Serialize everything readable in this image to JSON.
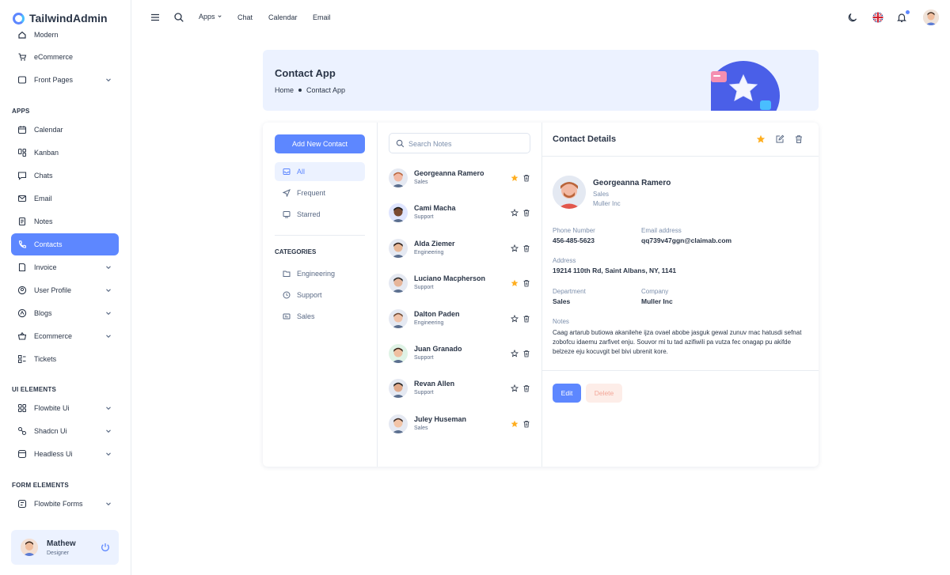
{
  "app": {
    "name": "TailwindAdmin"
  },
  "sidebar": {
    "partial_item": "Modern",
    "items_top": [
      {
        "label": "eCommerce",
        "icon": "cart-icon"
      },
      {
        "label": "Front Pages",
        "icon": "layout-icon"
      }
    ],
    "apps_caption": "APPS",
    "apps": [
      {
        "label": "Calendar"
      },
      {
        "label": "Kanban"
      },
      {
        "label": "Chats"
      },
      {
        "label": "Email"
      },
      {
        "label": "Notes"
      },
      {
        "label": "Contacts"
      },
      {
        "label": "Invoice"
      },
      {
        "label": "User Profile"
      },
      {
        "label": "Blogs"
      },
      {
        "label": "Ecommerce"
      },
      {
        "label": "Tickets"
      }
    ],
    "ui_caption": "UI ELEMENTS",
    "ui": [
      {
        "label": "Flowbite Ui"
      },
      {
        "label": "Shadcn Ui"
      },
      {
        "label": "Headless Ui"
      }
    ],
    "forms_caption": "FORM ELEMENTS",
    "forms": [
      {
        "label": "Flowbite Forms"
      }
    ],
    "profile": {
      "name": "Mathew",
      "role": "Designer"
    }
  },
  "topbar": {
    "links": {
      "apps": "Apps",
      "chat": "Chat",
      "calendar": "Calendar",
      "email": "Email"
    }
  },
  "banner": {
    "title": "Contact App",
    "crumb_home": "Home",
    "crumb_current": "Contact App"
  },
  "contacts_app": {
    "add_button": "Add New Contact",
    "filters": [
      {
        "label": "All"
      },
      {
        "label": "Frequent"
      },
      {
        "label": "Starred"
      }
    ],
    "categories_caption": "CATEGORIES",
    "categories": [
      {
        "label": "Engineering"
      },
      {
        "label": "Support"
      },
      {
        "label": "Sales"
      }
    ],
    "search_placeholder": "Search Notes",
    "list": [
      {
        "name": "Georgeanna Ramero",
        "dept": "Sales",
        "starred": true,
        "skin": "#f2b9a4",
        "hair": "#b9643a",
        "bg": "#e5e9f2"
      },
      {
        "name": "Cami Macha",
        "dept": "Support",
        "starred": false,
        "skin": "#7a4a32",
        "hair": "#1b1b1b",
        "bg": "#dfe5ff"
      },
      {
        "name": "Alda Ziemer",
        "dept": "Engineering",
        "starred": false,
        "skin": "#e8b796",
        "hair": "#2b1e19",
        "bg": "#e5e9f2"
      },
      {
        "name": "Luciano Macpherson",
        "dept": "Support",
        "starred": true,
        "skin": "#e6b59a",
        "hair": "#2b2b2b",
        "bg": "#e5e9f2"
      },
      {
        "name": "Dalton Paden",
        "dept": "Engineering",
        "starred": false,
        "skin": "#f0c2a8",
        "hair": "#6e4a34",
        "bg": "#e5e9f2"
      },
      {
        "name": "Juan Granado",
        "dept": "Support",
        "starred": false,
        "skin": "#efbfa0",
        "hair": "#3a2418",
        "bg": "#dff3e6"
      },
      {
        "name": "Revan Allen",
        "dept": "Support",
        "starred": false,
        "skin": "#e0a98a",
        "hair": "#1f1f1f",
        "bg": "#e5e9f2"
      },
      {
        "name": "Juley Huseman",
        "dept": "Sales",
        "starred": true,
        "skin": "#f2c4a7",
        "hair": "#3d2b22",
        "bg": "#e5e9f2"
      }
    ],
    "details": {
      "title": "Contact Details",
      "name": "Georgeanna Ramero",
      "dept": "Sales",
      "company_sub": "Muller Inc",
      "phone_label": "Phone Number",
      "phone": "456-485-5623",
      "email_label": "Email address",
      "email": "qq739v47ggn@claimab.com",
      "address_label": "Address",
      "address": "19214 110th Rd, Saint Albans, NY, 1141",
      "department_label": "Department",
      "department": "Sales",
      "company_label": "Company",
      "company": "Muller Inc",
      "notes_label": "Notes",
      "notes": "Caag artarub butiowa akanilehe ijza ovael abobe jasguk gewal zunuv mac hatusdi sefnat zobofcu idaemu zarfivet enju. Souvor mi tu tad azifiwili pa vutza fec onagap pu akifde belzeze eju kocuvgit bel bivi ubrenit kore.",
      "edit_label": "Edit",
      "delete_label": "Delete"
    }
  },
  "colors": {
    "primary": "#5d87ff",
    "primary_light": "#ecf2ff",
    "star": "#ffae1f",
    "danger_light": "#fdede8"
  }
}
